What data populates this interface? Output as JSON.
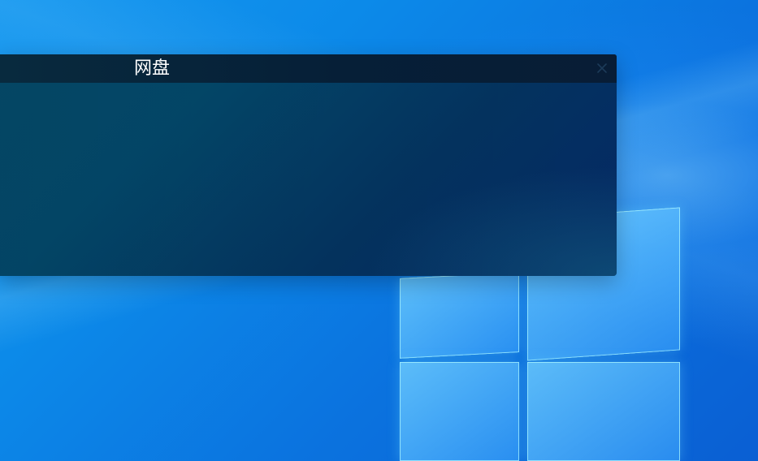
{
  "desktop": {
    "wallpaper_name": "windows-10-hero-wallpaper",
    "wallpaper_colors": {
      "primary": "#0c8ae9",
      "deep": "#0a5fd3",
      "glow": "#78c8ff"
    }
  },
  "window": {
    "title": "网盘",
    "close_icon": "close-icon",
    "colors": {
      "title_bar": "#061f37",
      "body": "#04335f",
      "text": "#ffffff",
      "close_icon": "#1c3b59"
    }
  }
}
